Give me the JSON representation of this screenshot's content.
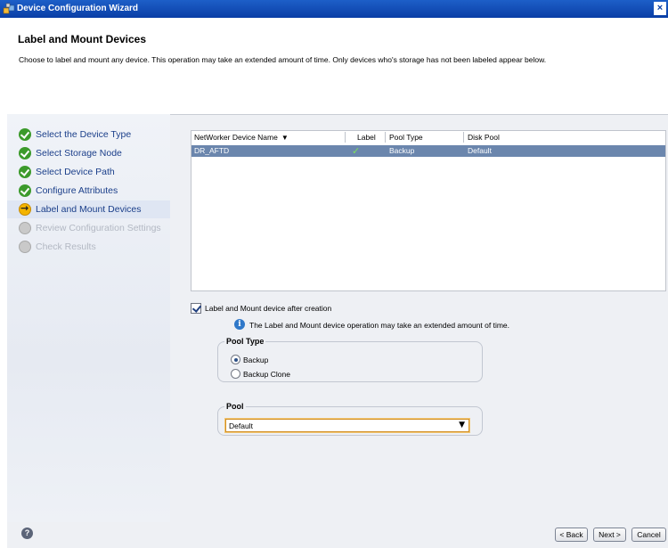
{
  "window": {
    "title": "Device Configuration Wizard",
    "close_glyph": "×"
  },
  "header": {
    "title": "Label and Mount Devices",
    "description": "Choose to label and mount any device. This operation may take an extended amount of time. Only devices who's storage has not been labeled appear below."
  },
  "steps": [
    {
      "label": "Select the Device Type",
      "state": "done"
    },
    {
      "label": "Select Storage Node",
      "state": "done"
    },
    {
      "label": "Select Device Path",
      "state": "done"
    },
    {
      "label": "Configure Attributes",
      "state": "done"
    },
    {
      "label": "Label and Mount Devices",
      "state": "current"
    },
    {
      "label": "Review Configuration Settings",
      "state": "pending"
    },
    {
      "label": "Check Results",
      "state": "pending"
    }
  ],
  "device_table": {
    "columns": [
      "NetWorker Device Name",
      "Label",
      "Pool Type",
      "Disk Pool"
    ],
    "sort_indicator": "▼",
    "rows": [
      {
        "name": "DR_AFTD",
        "label_icon": "check-icon",
        "pool_type": "Backup",
        "disk_pool": "Default",
        "selected": true
      }
    ]
  },
  "label_mount_option": {
    "label": "Label and Mount device after creation",
    "checked": true
  },
  "info_message": "The Label and Mount device operation may take an extended amount of time.",
  "pool_type": {
    "title": "Pool Type",
    "options": [
      {
        "label": "Backup",
        "selected": true
      },
      {
        "label": "Backup Clone",
        "selected": false
      }
    ]
  },
  "pool": {
    "title": "Pool",
    "value": "Default",
    "arrow": "▼"
  },
  "footer": {
    "help_glyph": "?",
    "back_label": "< Back",
    "next_label": "Next >",
    "cancel_label": "Cancel"
  },
  "colors": {
    "titlebar": "#0a3ea6",
    "selected_row": "#6b86ad",
    "done_step": "#3c9a2b",
    "current_step": "#f4b400"
  }
}
